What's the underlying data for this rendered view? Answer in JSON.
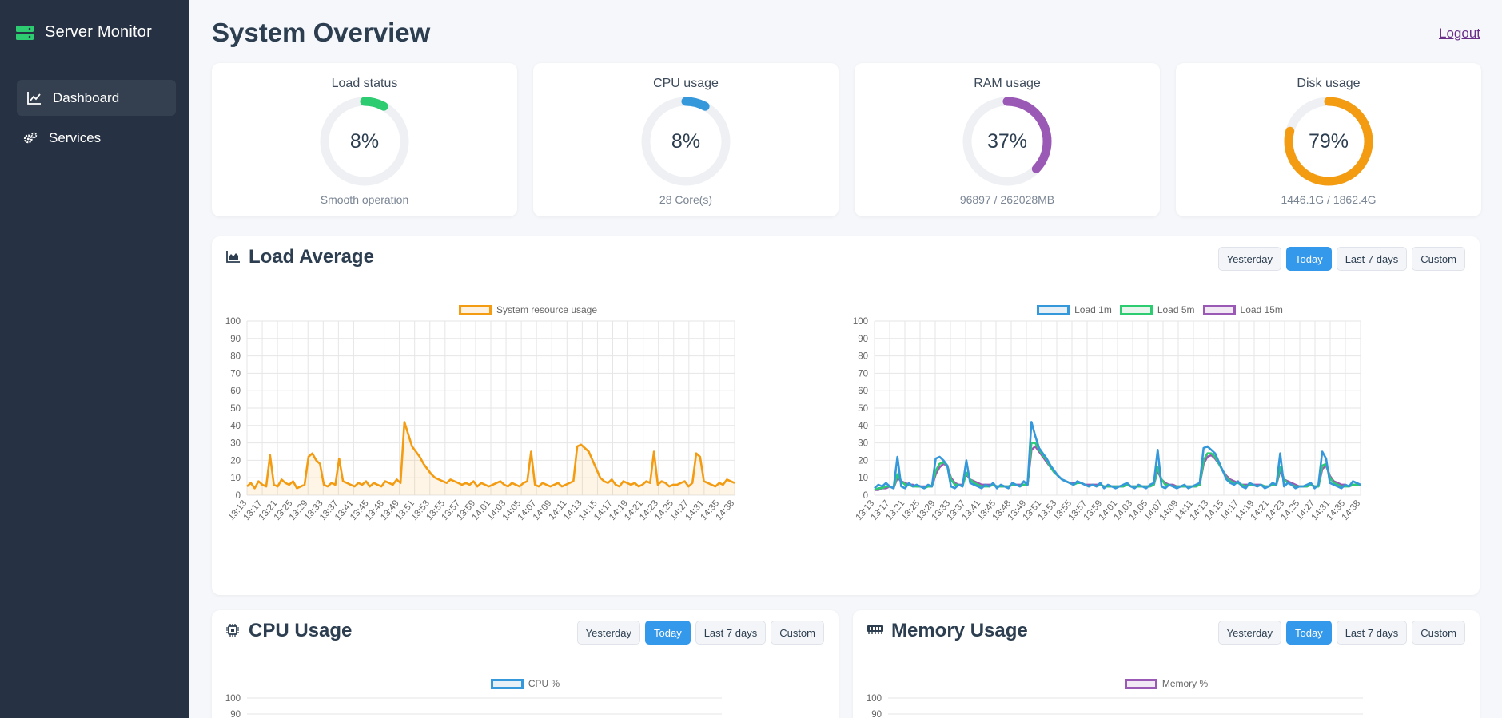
{
  "app": {
    "title": "Server Monitor"
  },
  "sidebar": {
    "items": [
      {
        "label": "Dashboard",
        "icon": "chart-line-icon",
        "active": true
      },
      {
        "label": "Services",
        "icon": "cogs-icon",
        "active": false
      }
    ]
  },
  "header": {
    "title": "System Overview",
    "logout": "Logout"
  },
  "stats": [
    {
      "title": "Load status",
      "value": "8%",
      "percent": 8,
      "sub": "Smooth operation",
      "color": "#2ecc71"
    },
    {
      "title": "CPU usage",
      "value": "8%",
      "percent": 8,
      "sub": "28 Core(s)",
      "color": "#3498db"
    },
    {
      "title": "RAM usage",
      "value": "37%",
      "percent": 37,
      "sub": "96897 / 262028MB",
      "color": "#9b59b6"
    },
    {
      "title": "Disk usage",
      "value": "79%",
      "percent": 79,
      "sub": "1446.1G / 1862.4G",
      "color": "#f39c12"
    }
  ],
  "ranges": [
    "Yesterday",
    "Today",
    "Last 7 days",
    "Custom"
  ],
  "active_range": "Today",
  "sections": {
    "load": {
      "title": "Load Average"
    },
    "cpu": {
      "title": "CPU Usage"
    },
    "memory": {
      "title": "Memory Usage"
    }
  },
  "colors": {
    "load_sys": "#f39c12",
    "load1": "#3498db",
    "load5": "#2ecc71",
    "load15": "#9b59b6",
    "cpu": "#3498db",
    "mem": "#9b59b6"
  },
  "chart_data": [
    {
      "type": "area",
      "series": [
        {
          "name": "System resource usage",
          "color": "#f39c12",
          "values": [
            5,
            7,
            4,
            8,
            6,
            5,
            23,
            6,
            5,
            9,
            7,
            6,
            8,
            4,
            5,
            6,
            22,
            24,
            20,
            18,
            6,
            5,
            7,
            6,
            21,
            8,
            7,
            6,
            5,
            7,
            6,
            8,
            5,
            7,
            6,
            5,
            8,
            7,
            6,
            9,
            7,
            42,
            35,
            28,
            25,
            22,
            18,
            15,
            12,
            10,
            9,
            8,
            7,
            9,
            8,
            7,
            6,
            7,
            6,
            8,
            5,
            7,
            6,
            5,
            6,
            7,
            8,
            6,
            5,
            7,
            6,
            5,
            7,
            8,
            25,
            6,
            5,
            7,
            6,
            5,
            6,
            7,
            5,
            6,
            7,
            8,
            28,
            29,
            27,
            25,
            20,
            15,
            10,
            8,
            7,
            9,
            6,
            5,
            8,
            7,
            6,
            7,
            5,
            6,
            8,
            7,
            25,
            6,
            8,
            7,
            5,
            6,
            6,
            7,
            8,
            5,
            7,
            24,
            22,
            8,
            7,
            6,
            5,
            7,
            6,
            9,
            8,
            7
          ]
        }
      ],
      "x_ticks": [
        "13:13",
        "13:17",
        "13:21",
        "13:25",
        "13:29",
        "13:33",
        "13:37",
        "13:41",
        "13:45",
        "13:48",
        "13:49",
        "13:51",
        "13:53",
        "13:55",
        "13:57",
        "13:59",
        "14:01",
        "14:03",
        "14:05",
        "14:07",
        "14:09",
        "14:11",
        "14:13",
        "14:15",
        "14:17",
        "14:19",
        "14:21",
        "14:23",
        "14:25",
        "14:27",
        "14:31",
        "14:35",
        "14:38"
      ],
      "y_ticks": [
        0,
        10,
        20,
        30,
        40,
        50,
        60,
        70,
        80,
        90,
        100
      ],
      "ylim": [
        0,
        100
      ]
    },
    {
      "type": "line",
      "series": [
        {
          "name": "Load 1m",
          "color": "#3498db",
          "values": [
            4,
            6,
            5,
            7,
            5,
            4,
            22,
            5,
            4,
            7,
            5,
            6,
            5,
            4,
            6,
            5,
            21,
            22,
            20,
            17,
            5,
            4,
            6,
            5,
            20,
            7,
            6,
            5,
            4,
            6,
            5,
            7,
            4,
            6,
            5,
            4,
            7,
            6,
            5,
            8,
            6,
            42,
            34,
            27,
            24,
            21,
            17,
            14,
            11,
            9,
            8,
            7,
            6,
            8,
            7,
            6,
            5,
            6,
            5,
            7,
            4,
            6,
            5,
            4,
            5,
            6,
            7,
            5,
            4,
            6,
            5,
            4,
            6,
            7,
            26,
            5,
            4,
            6,
            5,
            4,
            5,
            6,
            4,
            5,
            6,
            7,
            27,
            28,
            26,
            24,
            19,
            14,
            9,
            7,
            6,
            8,
            5,
            4,
            7,
            6,
            5,
            6,
            4,
            5,
            7,
            6,
            24,
            5,
            7,
            6,
            4,
            5,
            5,
            6,
            7,
            4,
            6,
            25,
            21,
            7,
            6,
            5,
            4,
            6,
            5,
            8,
            7,
            6
          ]
        },
        {
          "name": "Load 5m",
          "color": "#2ecc71",
          "values": [
            3,
            4,
            4,
            5,
            5,
            4,
            12,
            8,
            6,
            6,
            5,
            5,
            5,
            4,
            5,
            5,
            14,
            18,
            19,
            17,
            9,
            6,
            6,
            5,
            13,
            9,
            7,
            6,
            5,
            5,
            5,
            6,
            5,
            5,
            5,
            5,
            6,
            6,
            5,
            6,
            6,
            30,
            30,
            26,
            23,
            20,
            16,
            13,
            11,
            9,
            8,
            7,
            6,
            7,
            7,
            6,
            5,
            6,
            5,
            6,
            5,
            5,
            5,
            5,
            5,
            5,
            6,
            5,
            5,
            5,
            5,
            5,
            5,
            6,
            16,
            9,
            6,
            6,
            5,
            5,
            5,
            5,
            5,
            5,
            5,
            6,
            20,
            24,
            24,
            22,
            18,
            14,
            10,
            8,
            7,
            7,
            6,
            5,
            6,
            6,
            5,
            6,
            5,
            5,
            6,
            6,
            16,
            9,
            7,
            6,
            5,
            5,
            5,
            5,
            6,
            5,
            5,
            17,
            18,
            10,
            7,
            6,
            5,
            5,
            5,
            6,
            6,
            6
          ]
        },
        {
          "name": "Load 15m",
          "color": "#9b59b6",
          "values": [
            3,
            3,
            4,
            4,
            5,
            4,
            10,
            8,
            7,
            6,
            6,
            5,
            5,
            5,
            5,
            5,
            12,
            16,
            18,
            17,
            10,
            7,
            6,
            6,
            12,
            9,
            8,
            7,
            6,
            6,
            6,
            6,
            5,
            5,
            5,
            5,
            6,
            6,
            6,
            6,
            6,
            26,
            28,
            25,
            22,
            19,
            16,
            13,
            11,
            9,
            8,
            7,
            7,
            7,
            7,
            6,
            6,
            6,
            6,
            6,
            5,
            5,
            5,
            5,
            5,
            5,
            6,
            5,
            5,
            5,
            5,
            5,
            5,
            6,
            14,
            9,
            7,
            6,
            6,
            5,
            5,
            5,
            5,
            5,
            5,
            6,
            18,
            22,
            23,
            21,
            18,
            14,
            11,
            9,
            8,
            7,
            6,
            6,
            6,
            6,
            6,
            6,
            5,
            5,
            6,
            6,
            14,
            9,
            8,
            7,
            6,
            5,
            5,
            5,
            6,
            5,
            5,
            15,
            17,
            11,
            8,
            7,
            6,
            6,
            5,
            6,
            6,
            6
          ]
        }
      ],
      "x_ticks": [
        "13:13",
        "13:17",
        "13:21",
        "13:25",
        "13:29",
        "13:33",
        "13:37",
        "13:41",
        "13:45",
        "13:48",
        "13:49",
        "13:51",
        "13:53",
        "13:55",
        "13:57",
        "13:59",
        "14:01",
        "14:03",
        "14:05",
        "14:07",
        "14:09",
        "14:11",
        "14:13",
        "14:15",
        "14:17",
        "14:19",
        "14:21",
        "14:23",
        "14:25",
        "14:27",
        "14:31",
        "14:35",
        "14:38"
      ],
      "y_ticks": [
        0,
        10,
        20,
        30,
        40,
        50,
        60,
        70,
        80,
        90,
        100
      ],
      "ylim": [
        0,
        100
      ]
    },
    {
      "type": "line",
      "series": [
        {
          "name": "CPU %",
          "color": "#3498db",
          "values": []
        }
      ],
      "y_ticks": [
        100,
        90
      ],
      "ylim": [
        0,
        100
      ]
    },
    {
      "type": "line",
      "series": [
        {
          "name": "Memory %",
          "color": "#9b59b6",
          "values": []
        }
      ],
      "y_ticks": [
        100,
        90
      ],
      "ylim": [
        0,
        100
      ]
    }
  ]
}
